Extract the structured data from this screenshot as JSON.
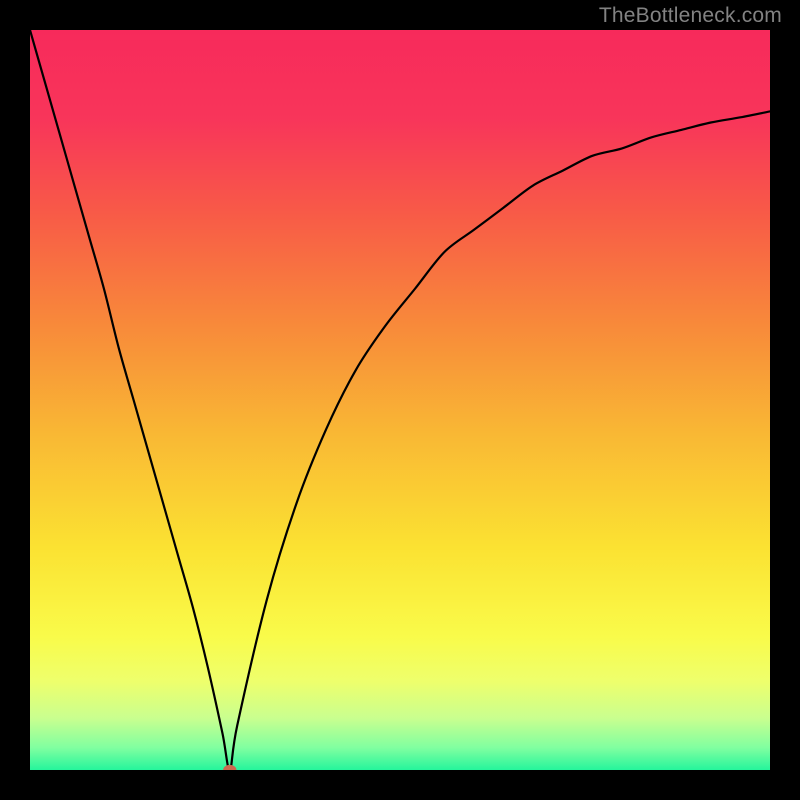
{
  "watermark": "TheBottleneck.com",
  "chart_data": {
    "type": "line",
    "title": "",
    "xlabel": "",
    "ylabel": "",
    "xlim": [
      0,
      100
    ],
    "ylim": [
      0,
      100
    ],
    "grid": false,
    "series": [
      {
        "name": "curve",
        "color": "#000000",
        "x": [
          0,
          2,
          4,
          6,
          8,
          10,
          12,
          14,
          16,
          18,
          20,
          22,
          24,
          26,
          27,
          28,
          32,
          36,
          40,
          44,
          48,
          52,
          56,
          60,
          64,
          68,
          72,
          76,
          80,
          84,
          88,
          92,
          96,
          100
        ],
        "y": [
          100,
          93,
          86,
          79,
          72,
          65,
          57,
          50,
          43,
          36,
          29,
          22,
          14,
          5,
          0,
          6,
          23,
          36,
          46,
          54,
          60,
          65,
          70,
          73,
          76,
          79,
          81,
          83,
          84,
          85.5,
          86.5,
          87.5,
          88.2,
          89
        ]
      }
    ],
    "marker": {
      "x": 27,
      "y": 0,
      "rx": 0.9,
      "ry": 0.7,
      "color": "#cc6b4f"
    },
    "background_gradient": {
      "stops": [
        {
          "offset": 0.0,
          "color": "#f72a5b"
        },
        {
          "offset": 0.12,
          "color": "#f8355a"
        },
        {
          "offset": 0.25,
          "color": "#f85b47"
        },
        {
          "offset": 0.4,
          "color": "#f88a3a"
        },
        {
          "offset": 0.55,
          "color": "#f9b934"
        },
        {
          "offset": 0.7,
          "color": "#fbe232"
        },
        {
          "offset": 0.82,
          "color": "#f9fb4a"
        },
        {
          "offset": 0.88,
          "color": "#eeff6c"
        },
        {
          "offset": 0.93,
          "color": "#c9ff8f"
        },
        {
          "offset": 0.97,
          "color": "#80ffa0"
        },
        {
          "offset": 1.0,
          "color": "#25f59c"
        }
      ]
    }
  }
}
